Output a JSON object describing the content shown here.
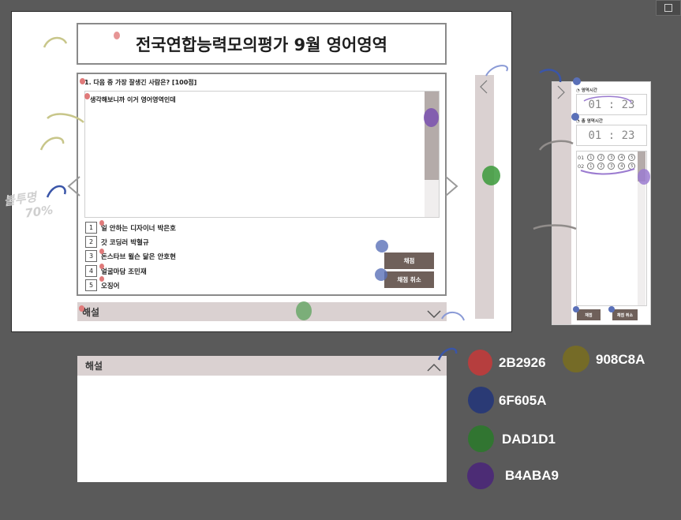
{
  "header": {
    "title": "전국연합능력모의평가 9월 영어영역"
  },
  "question": {
    "text": "1. 다음 중 가장 잘생긴 사람은? [100점]",
    "passage": "생각해보니까 이거 영어영역인데",
    "choices": [
      {
        "num": "1",
        "label": "일 안하는 디자이너 박은호"
      },
      {
        "num": "2",
        "label": "갓 코딩러 박혈규"
      },
      {
        "num": "3",
        "label": "돈스타브 윌슨 닮은 안호현"
      },
      {
        "num": "4",
        "label": "얼굴마담 조민재"
      },
      {
        "num": "5",
        "label": "오징어"
      }
    ]
  },
  "buttons": {
    "grade": "채점",
    "cancel": "채점 취소"
  },
  "explanation": {
    "label": "해설"
  },
  "sidebar": {
    "timer1_label": "영역시간",
    "timer1_value": "01 : 23",
    "timer2_label": "총 영역시간",
    "timer2_value": "01 : 23",
    "omr_rows": [
      {
        "q": "01",
        "opts": [
          "1",
          "2",
          "3",
          "4",
          "5"
        ]
      },
      {
        "q": "02",
        "opts": [
          "1",
          "2",
          "3",
          "4",
          "5"
        ]
      }
    ],
    "grade_button": "채점",
    "cancel_button": "채점 취소"
  },
  "annotation": {
    "line1": "불투명",
    "line2": "70%"
  },
  "palette": [
    {
      "hex": "2B2926",
      "dot_color": "#d03838"
    },
    {
      "hex": "908C8A",
      "dot_color": "#8a7e26"
    },
    {
      "hex": "6F605A",
      "dot_color": "#2a3f8c"
    },
    {
      "hex": "DAD1D1",
      "dot_color": "#2f8a2f"
    },
    {
      "hex": "B4ABA9",
      "dot_color": "#5a2f8c"
    }
  ],
  "colors": {
    "brown": "#6F605A",
    "pink": "#DAD1D1",
    "mauve": "#B4ABA9",
    "dark": "#2B2926",
    "gray": "#908C8A"
  }
}
